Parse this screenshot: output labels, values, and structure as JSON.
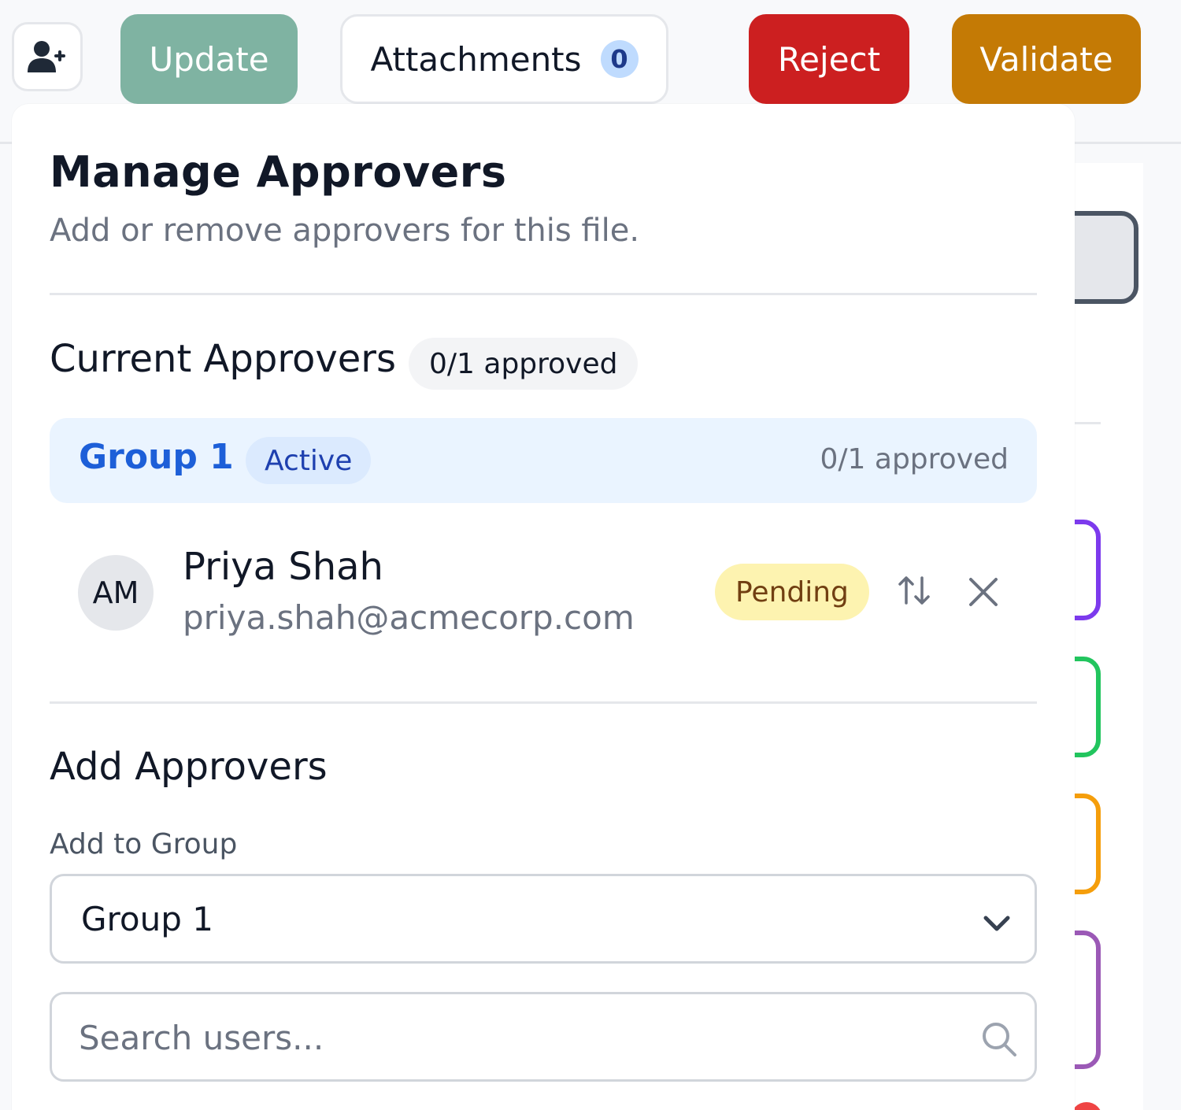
{
  "toolbar": {
    "icon_button": "user-plus-icon",
    "update_label": "Update",
    "attachments_label": "Attachments",
    "attachments_count": "0",
    "reject_label": "Reject",
    "validate_label": "Validate"
  },
  "colors": {
    "update": "#7fb3a2",
    "reject": "#cc1f20",
    "validate": "#c47a05",
    "group_accent": "#1d5fd8",
    "pending_bg": "#fdf3b0"
  },
  "panel": {
    "title": "Manage Approvers",
    "subtitle": "Add or remove approvers for this file."
  },
  "current": {
    "title": "Current Approvers",
    "summary": "0/1 approved",
    "groups": [
      {
        "name": "Group 1",
        "status": "Active",
        "progress": "0/1 approved",
        "approvers": [
          {
            "initials": "AM",
            "name": "Priya Shah",
            "email": "priya.shah@acmecorp.com",
            "status": "Pending"
          }
        ]
      }
    ]
  },
  "add": {
    "title": "Add Approvers",
    "group_label": "Add to Group",
    "group_selected": "Group 1",
    "search_placeholder": "Search users..."
  }
}
